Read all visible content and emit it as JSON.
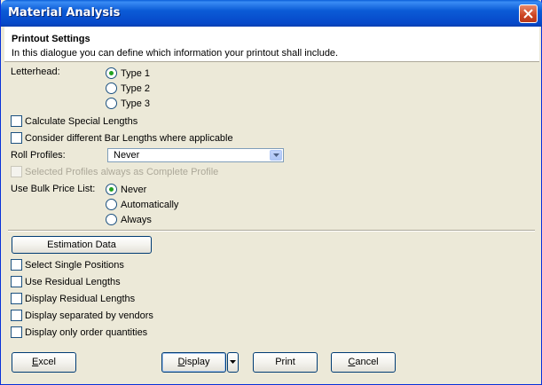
{
  "window": {
    "title": "Material Analysis"
  },
  "header": {
    "title": "Printout Settings",
    "description": "In this dialogue you can define which information your printout shall include."
  },
  "letterhead": {
    "label": "Letterhead:",
    "options": [
      {
        "label": "Type 1",
        "checked": true
      },
      {
        "label": "Type 2",
        "checked": false
      },
      {
        "label": "Type 3",
        "checked": false
      }
    ]
  },
  "options_top": {
    "calc_special_lengths": "Calculate Special Lengths",
    "consider_bar_lengths": "Consider different Bar Lengths where applicable"
  },
  "roll_profiles": {
    "label": "Roll Profiles:",
    "selected": "Never"
  },
  "selected_profiles_complete": "Selected Profiles always as Complete Profile",
  "bulk_price": {
    "label": "Use Bulk Price List:",
    "options": [
      {
        "label": "Never",
        "checked": true
      },
      {
        "label": "Automatically",
        "checked": false
      },
      {
        "label": "Always",
        "checked": false
      }
    ]
  },
  "estimation_button": "Estimation Data",
  "options_bottom": [
    "Select Single Positions",
    "Use Residual Lengths",
    "Display Residual Lengths",
    "Display separated by vendors",
    "Display only order quantities"
  ],
  "buttons": {
    "excel": {
      "mnemonic": "E",
      "rest": "xcel"
    },
    "display": {
      "mnemonic": "D",
      "rest": "isplay"
    },
    "print": "Print",
    "cancel": {
      "mnemonic": "C",
      "rest": "ancel"
    }
  },
  "colors": {
    "titlebar": "#0b5bd6",
    "dialog_bg": "#ece9d8",
    "radio_dot": "#21a121",
    "button_border": "#003c74"
  }
}
